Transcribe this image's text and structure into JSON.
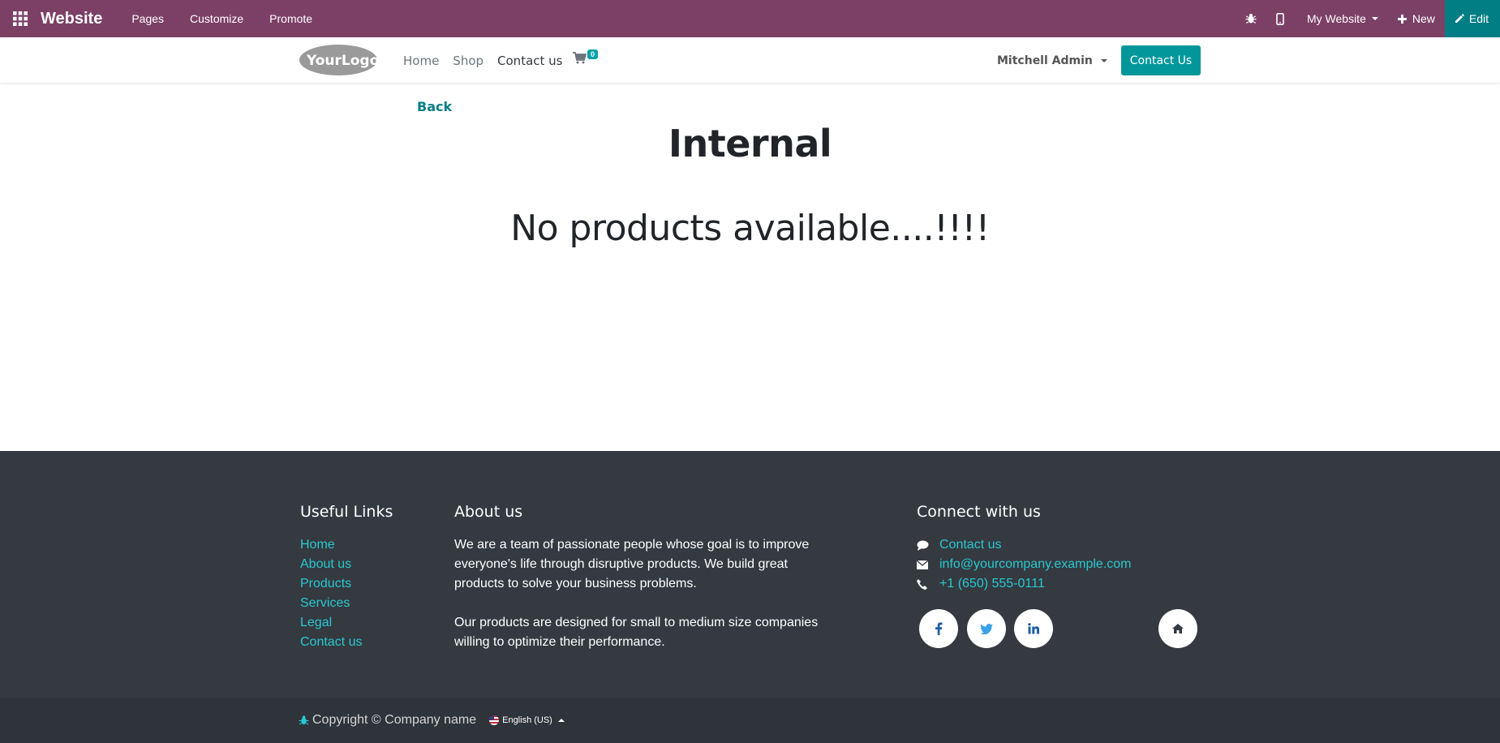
{
  "topbar": {
    "brand": "Website",
    "menu": [
      "Pages",
      "Customize",
      "Promote"
    ],
    "website_switcher": "My Website",
    "new_label": "New",
    "edit_label": "Edit",
    "colors": {
      "bar": "#7c4067",
      "edit": "#017e84"
    }
  },
  "header": {
    "logo_text": "YourLogo",
    "nav": [
      "Home",
      "Shop",
      "Contact us"
    ],
    "cart_count": "0",
    "user": "Mitchell Admin",
    "contact_button": "Contact Us"
  },
  "main": {
    "back_label": "Back",
    "title": "Internal",
    "message": "No products available....!!!!"
  },
  "footer": {
    "useful_links": {
      "heading": "Useful Links",
      "items": [
        "Home",
        "About us",
        "Products",
        "Services",
        "Legal",
        "Contact us"
      ]
    },
    "about": {
      "heading": "About us",
      "p1": "We are a team of passionate people whose goal is to improve everyone's life through disruptive products. We build great products to solve your business problems.",
      "p2": "Our products are designed for small to medium size companies willing to optimize their performance."
    },
    "connect": {
      "heading": "Connect with us",
      "contact": "Contact us",
      "email": "info@yourcompany.example.com",
      "phone": "+1 (650) 555-0111",
      "social": [
        "facebook-icon",
        "twitter-icon",
        "linkedin-icon",
        "home-icon"
      ]
    },
    "copyright": "Copyright © Company name",
    "language": "English (US)"
  }
}
